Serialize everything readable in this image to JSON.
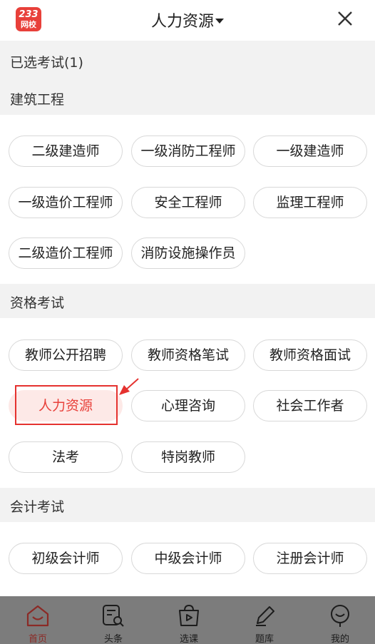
{
  "header": {
    "logo_line1": "233",
    "logo_line2": "网校",
    "title": "人力资源",
    "close_label": "×"
  },
  "selected": {
    "label": "已选考试(1)",
    "category": "建筑工程"
  },
  "sections": [
    {
      "title": "建筑工程",
      "items": [
        "二级建造师",
        "一级消防工程师",
        "一级建造师",
        "一级造价工程师",
        "安全工程师",
        "监理工程师",
        "二级造价工程师",
        "消防设施操作员"
      ]
    },
    {
      "title": "资格考试",
      "items": [
        "教师公开招聘",
        "教师资格笔试",
        "教师资格面试",
        "人力资源",
        "心理咨询",
        "社会工作者",
        "法考",
        "特岗教师"
      ]
    },
    {
      "title": "会计考试",
      "items": [
        "初级会计师",
        "中级会计师",
        "注册会计师"
      ]
    }
  ],
  "selected_exam": "人力资源",
  "tabbar": {
    "items": [
      {
        "label": "首页",
        "icon": "home-icon",
        "active": true
      },
      {
        "label": "头条",
        "icon": "news-icon"
      },
      {
        "label": "选课",
        "icon": "course-bag-icon"
      },
      {
        "label": "题库",
        "icon": "pencil-icon"
      },
      {
        "label": "我的",
        "icon": "profile-icon"
      }
    ]
  },
  "colors": {
    "brand": "#e8403a",
    "selected_bg": "#fde9e7",
    "section_bg": "#f2f2f2",
    "annotation": "#e5322f"
  }
}
